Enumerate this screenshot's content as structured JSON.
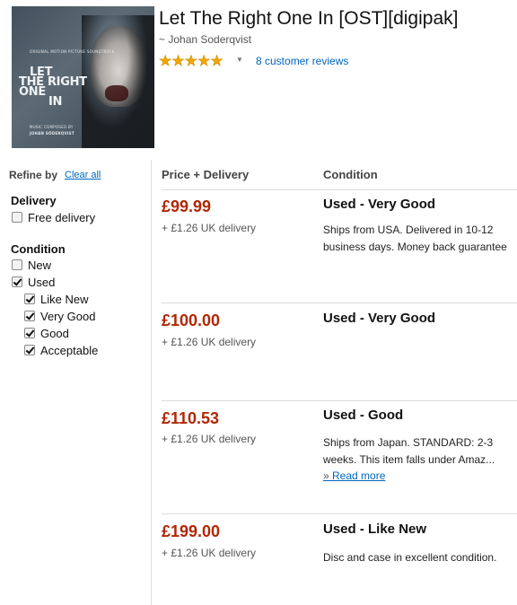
{
  "product": {
    "title": "Let The Right One In [OST][digipak]",
    "artist": "~ Johan Soderqvist",
    "stars": "★★★★★",
    "reviews_link": "8 customer reviews",
    "cover": {
      "small_top": "ORIGINAL MOTION PICTURE SOUNDTRACK",
      "film_title_1": "LET",
      "film_title_2": "THE RIGHT ONE",
      "film_title_3": "IN",
      "composer_caption": "MUSIC COMPOSED BY",
      "composer_name": "JOHAN SÖDERQVIST"
    }
  },
  "sidebar": {
    "refine_label": "Refine by",
    "clear_all": "Clear all",
    "delivery": {
      "heading": "Delivery",
      "options": [
        {
          "label": "Free delivery",
          "checked": false
        }
      ]
    },
    "condition": {
      "heading": "Condition",
      "options": [
        {
          "label": "New",
          "checked": false
        },
        {
          "label": "Used",
          "checked": true
        },
        {
          "label": "Like New",
          "checked": true
        },
        {
          "label": "Very Good",
          "checked": true
        },
        {
          "label": "Good",
          "checked": true
        },
        {
          "label": "Acceptable",
          "checked": true
        }
      ]
    }
  },
  "columns": {
    "price_header": "Price + Delivery",
    "condition_header": "Condition"
  },
  "offers": [
    {
      "price": "£99.99",
      "delivery": "+ £1.26 UK delivery",
      "condition": "Used - Very Good",
      "desc_1": "Ships from USA. Delivered in 10-12",
      "desc_2": "business days. Money back guarantee",
      "desc_3": "",
      "read_more": ""
    },
    {
      "price": "£100.00",
      "delivery": "+ £1.26 UK delivery",
      "condition": "Used - Very Good",
      "desc_1": "",
      "desc_2": "",
      "desc_3": "",
      "read_more": ""
    },
    {
      "price": "£110.53",
      "delivery": "+ £1.26 UK delivery",
      "condition": "Used - Good",
      "desc_1": "Ships from Japan. STANDARD: 2-3",
      "desc_2": "weeks. This item falls under Amaz...",
      "desc_3": "",
      "read_more": "Read more"
    },
    {
      "price": "£199.00",
      "delivery": "+ £1.26 UK delivery",
      "condition": "Used - Like New",
      "desc_1": "Disc and case in excellent condition.",
      "desc_2": "",
      "desc_3": "",
      "read_more": ""
    }
  ],
  "colors": {
    "price": "#b12704",
    "link": "#0066c0",
    "star": "#f7a600"
  }
}
